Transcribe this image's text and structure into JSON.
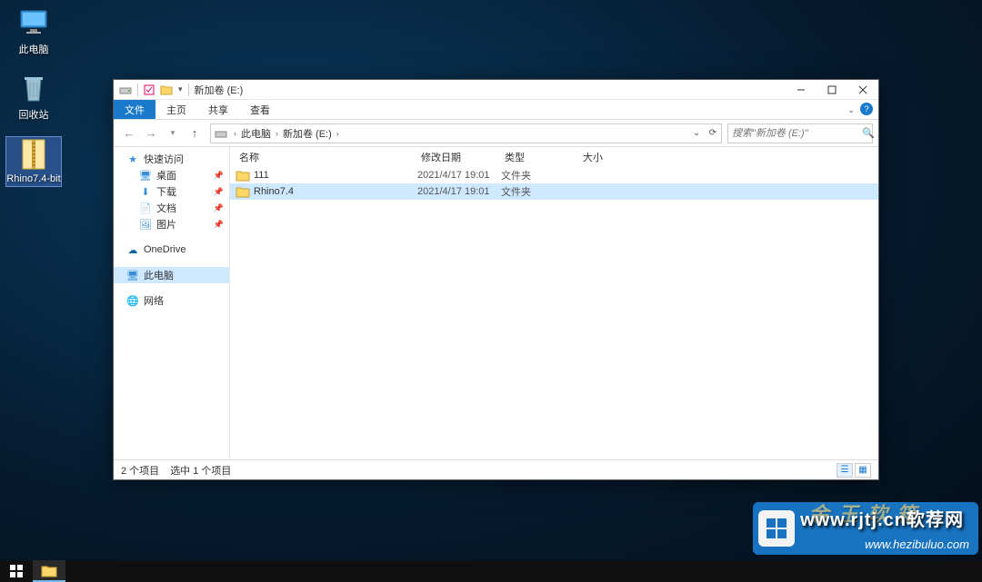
{
  "desktop": {
    "items": [
      {
        "name": "此电脑"
      },
      {
        "name": "回收站"
      },
      {
        "name": "Rhino7.4-bit"
      }
    ]
  },
  "explorer": {
    "title": "新加卷 (E:)",
    "ribbon": {
      "file": "文件",
      "home": "主页",
      "share": "共享",
      "view": "查看"
    },
    "breadcrumb": {
      "pc": "此电脑",
      "drive": "新加卷 (E:)"
    },
    "search_placeholder": "搜索\"新加卷 (E:)\"",
    "columns": {
      "name": "名称",
      "date": "修改日期",
      "type": "类型",
      "size": "大小"
    },
    "files": [
      {
        "name": "111",
        "date": "2021/4/17 19:01",
        "type": "文件夹",
        "size": "",
        "selected": false
      },
      {
        "name": "Rhino7.4",
        "date": "2021/4/17 19:01",
        "type": "文件夹",
        "size": "",
        "selected": true
      }
    ],
    "nav": {
      "quick": "快速访问",
      "desktop": "桌面",
      "downloads": "下载",
      "documents": "文档",
      "pictures": "图片",
      "onedrive": "OneDrive",
      "thispc": "此电脑",
      "network": "网络"
    },
    "status": {
      "count": "2 个项目",
      "selected": "选中 1 个项目"
    }
  },
  "watermark": {
    "top": "www.rjtj.cn软荐网",
    "bottom": "www.hezibuluo.com",
    "cn": "金 玉  软 箱"
  }
}
